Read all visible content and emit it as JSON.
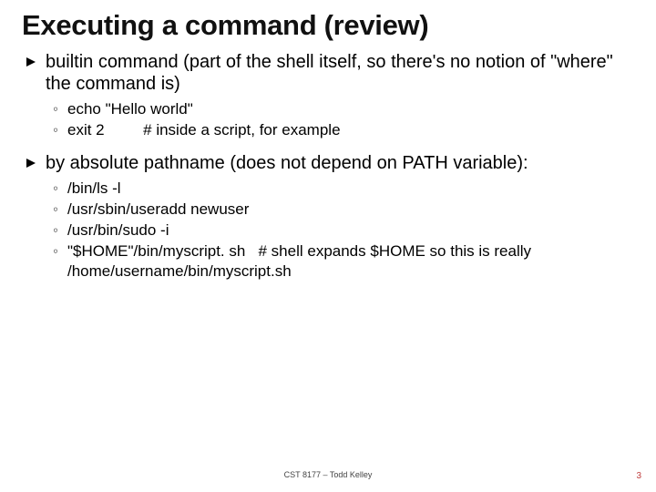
{
  "title": "Executing a command (review)",
  "bullet1": {
    "main": "builtin command (part of the shell itself, so there's no notion of \"where\" the command is)",
    "sub1": "echo \"Hello world\"",
    "sub2": "exit 2         # inside a script, for example"
  },
  "bullet2": {
    "main": "by absolute pathname (does not depend on PATH variable):",
    "sub1": "/bin/ls -l",
    "sub2": "/usr/sbin/useradd newuser",
    "sub3": "/usr/bin/sudo -i",
    "sub4": "\"$HOME\"/bin/myscript. sh   # shell expands $HOME so this is really /home/username/bin/myscript.sh"
  },
  "footer_center": "CST 8177 – Todd Kelley",
  "footer_right": "3"
}
